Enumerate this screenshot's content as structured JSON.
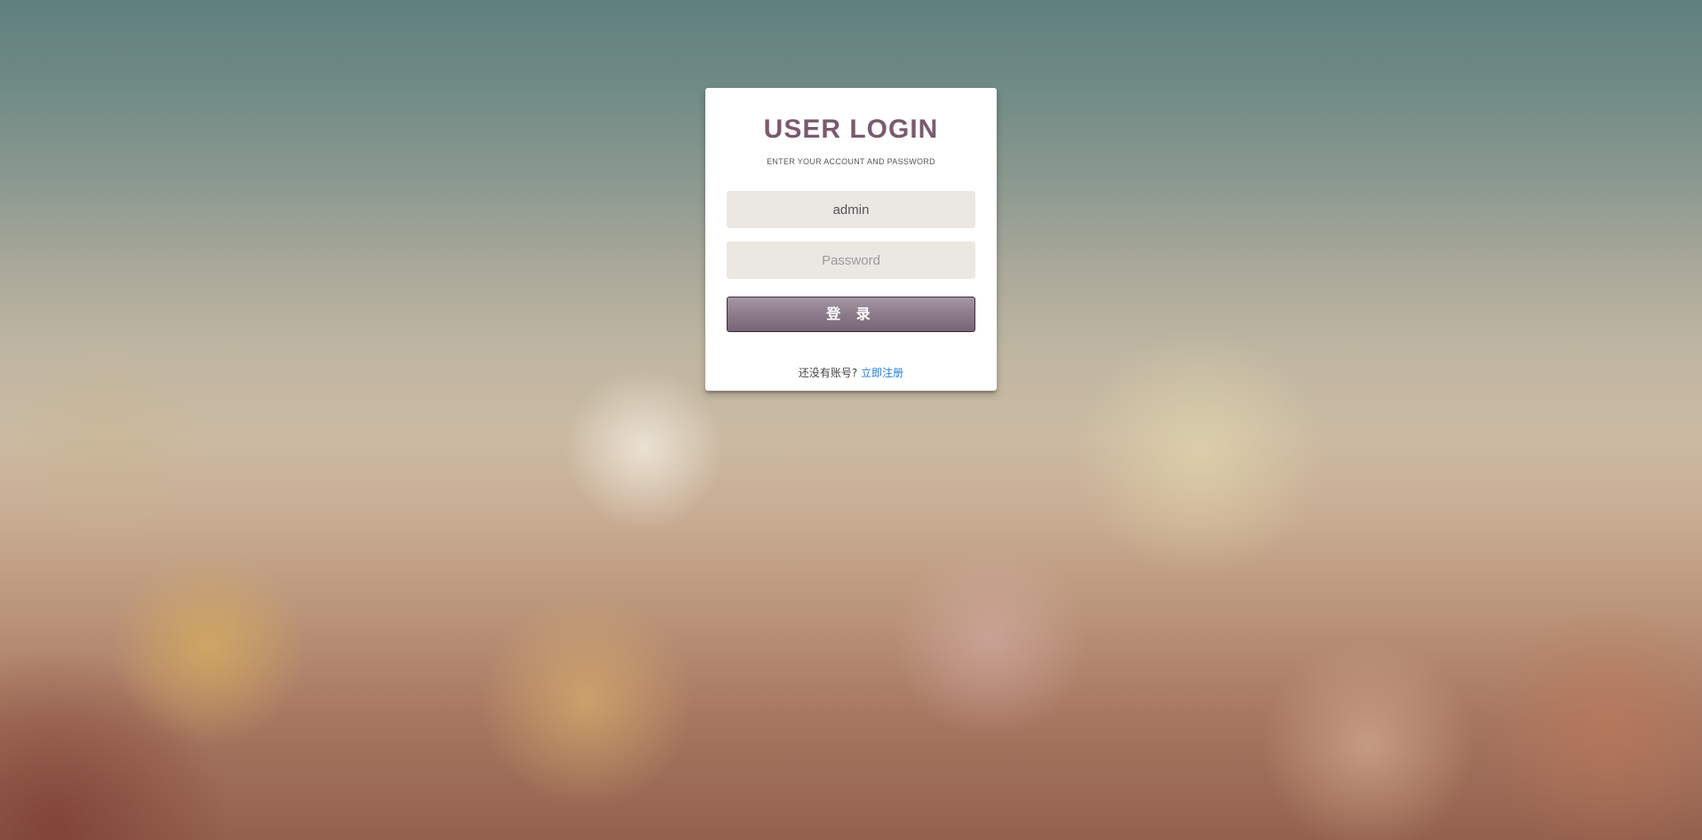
{
  "login": {
    "title": "USER LOGIN",
    "subtitle": "ENTER YOUR ACCOUNT AND PASSWORD",
    "username_value": "admin",
    "password_placeholder": "Password",
    "login_button_label": "登 录",
    "register_prompt": "还没有账号?",
    "register_link": "立即注册"
  },
  "colors": {
    "title": "#7a5a6e",
    "input_background": "#ebe7e3",
    "button_top": "#a597a4",
    "button_bottom": "#776575",
    "link": "#2a7fd4"
  }
}
